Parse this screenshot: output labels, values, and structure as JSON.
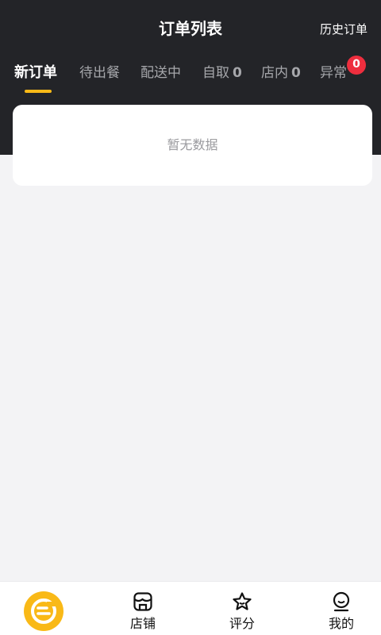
{
  "header": {
    "title": "订单列表",
    "history_link": "历史订单"
  },
  "tabs": [
    {
      "label": "新订单",
      "count": null,
      "active": true
    },
    {
      "label": "待出餐",
      "count": null,
      "active": false
    },
    {
      "label": "配送中",
      "count": null,
      "active": false
    },
    {
      "label": "自取",
      "count": "0",
      "active": false
    },
    {
      "label": "店内",
      "count": "0",
      "active": false
    },
    {
      "label": "异常",
      "count": null,
      "badge": "0",
      "active": false
    }
  ],
  "empty_state": {
    "text": "暂无数据"
  },
  "bottom_nav": {
    "home_icon": "brand-logo-icon",
    "items": [
      {
        "label": "店铺",
        "icon": "store-icon"
      },
      {
        "label": "评分",
        "icon": "star-icon"
      },
      {
        "label": "我的",
        "icon": "profile-icon"
      }
    ]
  },
  "colors": {
    "header_bg": "#232428",
    "accent": "#f9b917",
    "badge": "#ee2e3e",
    "page_bg": "#f3f3f5"
  }
}
